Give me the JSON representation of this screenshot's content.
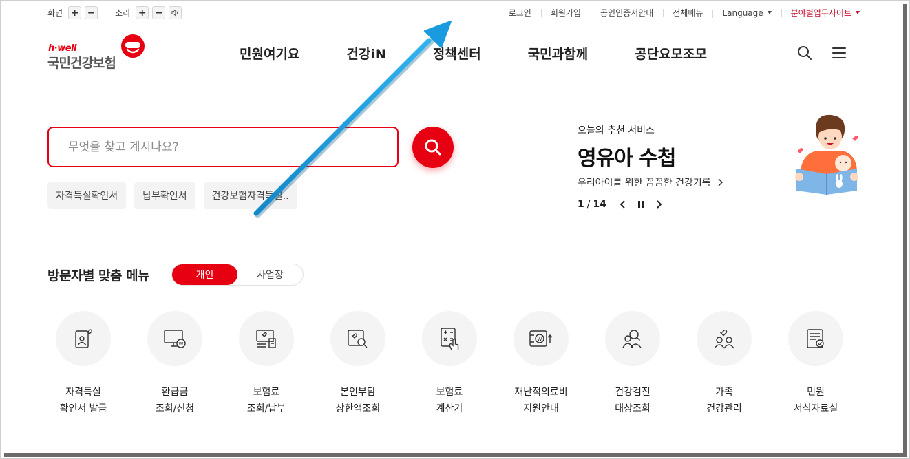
{
  "util": {
    "screen_label": "화면",
    "sound_label": "소리",
    "plus": "+",
    "minus": "−"
  },
  "top_links": [
    "로그인",
    "회원가입",
    "공인인증서안내",
    "전체메뉴"
  ],
  "language_label": "Language",
  "sites_label": "분야별업무사이트",
  "logo": {
    "sub": "h·well",
    "name": "국민건강보험"
  },
  "gnb": [
    "민원여기요",
    "건강iN",
    "정책센터",
    "국민과함께",
    "공단요모조모"
  ],
  "search": {
    "placeholder": "무엇을 찾고 계시나요?",
    "value": ""
  },
  "chips": [
    "자격득실확인서",
    "납부확인서",
    "건강보험자격득실.."
  ],
  "recommend": {
    "label": "오늘의 추천 서비스",
    "title": "영유아 수첩",
    "desc": "우리아이를 위한 꼼꼼한 건강기록",
    "page_current": "1",
    "page_sep": "/",
    "page_total": "14"
  },
  "visitor_menu": {
    "title": "방문자별 맞춤 메뉴",
    "options": [
      "개인",
      "사업장"
    ],
    "selected": "개인"
  },
  "quick_menu": [
    {
      "line1": "자격득실",
      "line2": "확인서 발급",
      "icon": "id-card-heart-icon"
    },
    {
      "line1": "환급금",
      "line2": "조회/신청",
      "icon": "monitor-won-icon"
    },
    {
      "line1": "보험료",
      "line2": "조회/납부",
      "icon": "bill-check-icon"
    },
    {
      "line1": "본인부담",
      "line2": "상한액조회",
      "icon": "heart-search-icon"
    },
    {
      "line1": "보험료",
      "line2": "계산기",
      "icon": "calculator-hand-icon"
    },
    {
      "line1": "재난적의료비",
      "line2": "지원안내",
      "icon": "wallet-won-icon"
    },
    {
      "line1": "건강검진",
      "line2": "대상조회",
      "icon": "people-search-icon"
    },
    {
      "line1": "가족",
      "line2": "건강관리",
      "icon": "family-heart-icon"
    },
    {
      "line1": "민원",
      "line2": "서식자료실",
      "icon": "document-check-icon"
    }
  ],
  "colors": {
    "brand_red": "#e60012",
    "annotation_arrow": "#1a9be0"
  }
}
